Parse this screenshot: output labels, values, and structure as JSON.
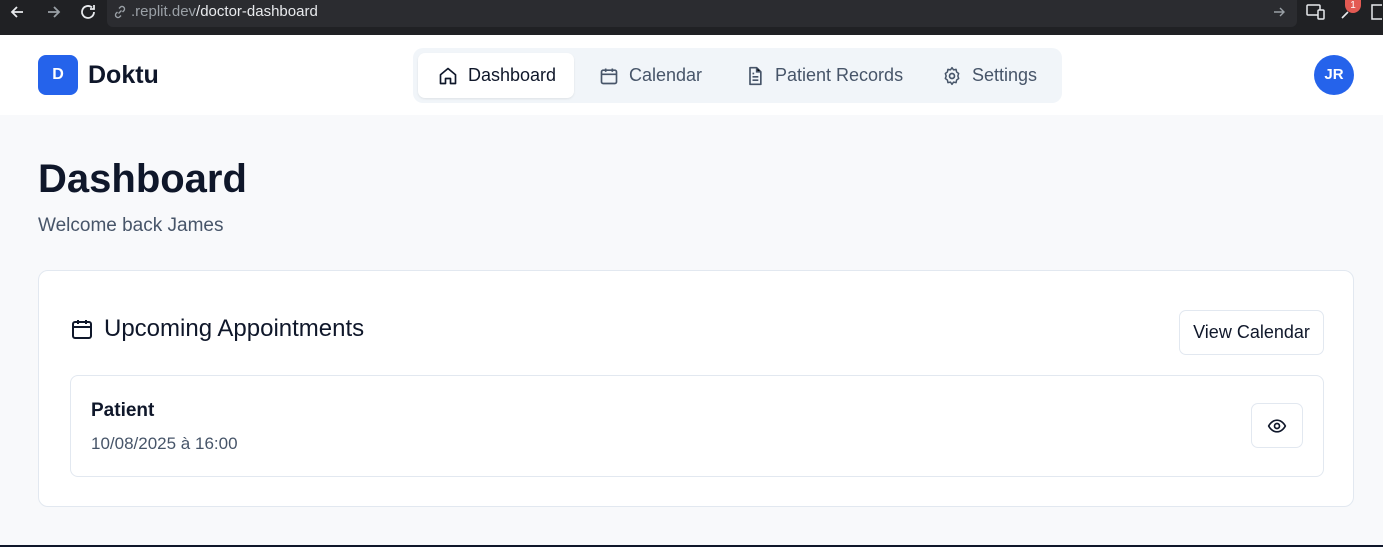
{
  "browser": {
    "url_host": ".replit.dev",
    "url_path": "/doctor-dashboard",
    "notification_count": "1"
  },
  "header": {
    "logo_letter": "D",
    "brand": "Doktu",
    "tabs": [
      {
        "label": "Dashboard",
        "icon": "home-icon",
        "active": true
      },
      {
        "label": "Calendar",
        "icon": "calendar-icon",
        "active": false
      },
      {
        "label": "Patient Records",
        "icon": "document-icon",
        "active": false
      },
      {
        "label": "Settings",
        "icon": "gear-icon",
        "active": false
      }
    ],
    "avatar_initials": "JR"
  },
  "page": {
    "title": "Dashboard",
    "subtitle": "Welcome back James"
  },
  "appointments": {
    "title": "Upcoming Appointments",
    "view_calendar_label": "View Calendar",
    "items": [
      {
        "name": "Patient",
        "datetime": "10/08/2025 à 16:00"
      }
    ]
  },
  "colors": {
    "accent": "#2563eb",
    "background": "#f8f9fb",
    "text": "#0f172a",
    "muted_text": "#475569"
  }
}
